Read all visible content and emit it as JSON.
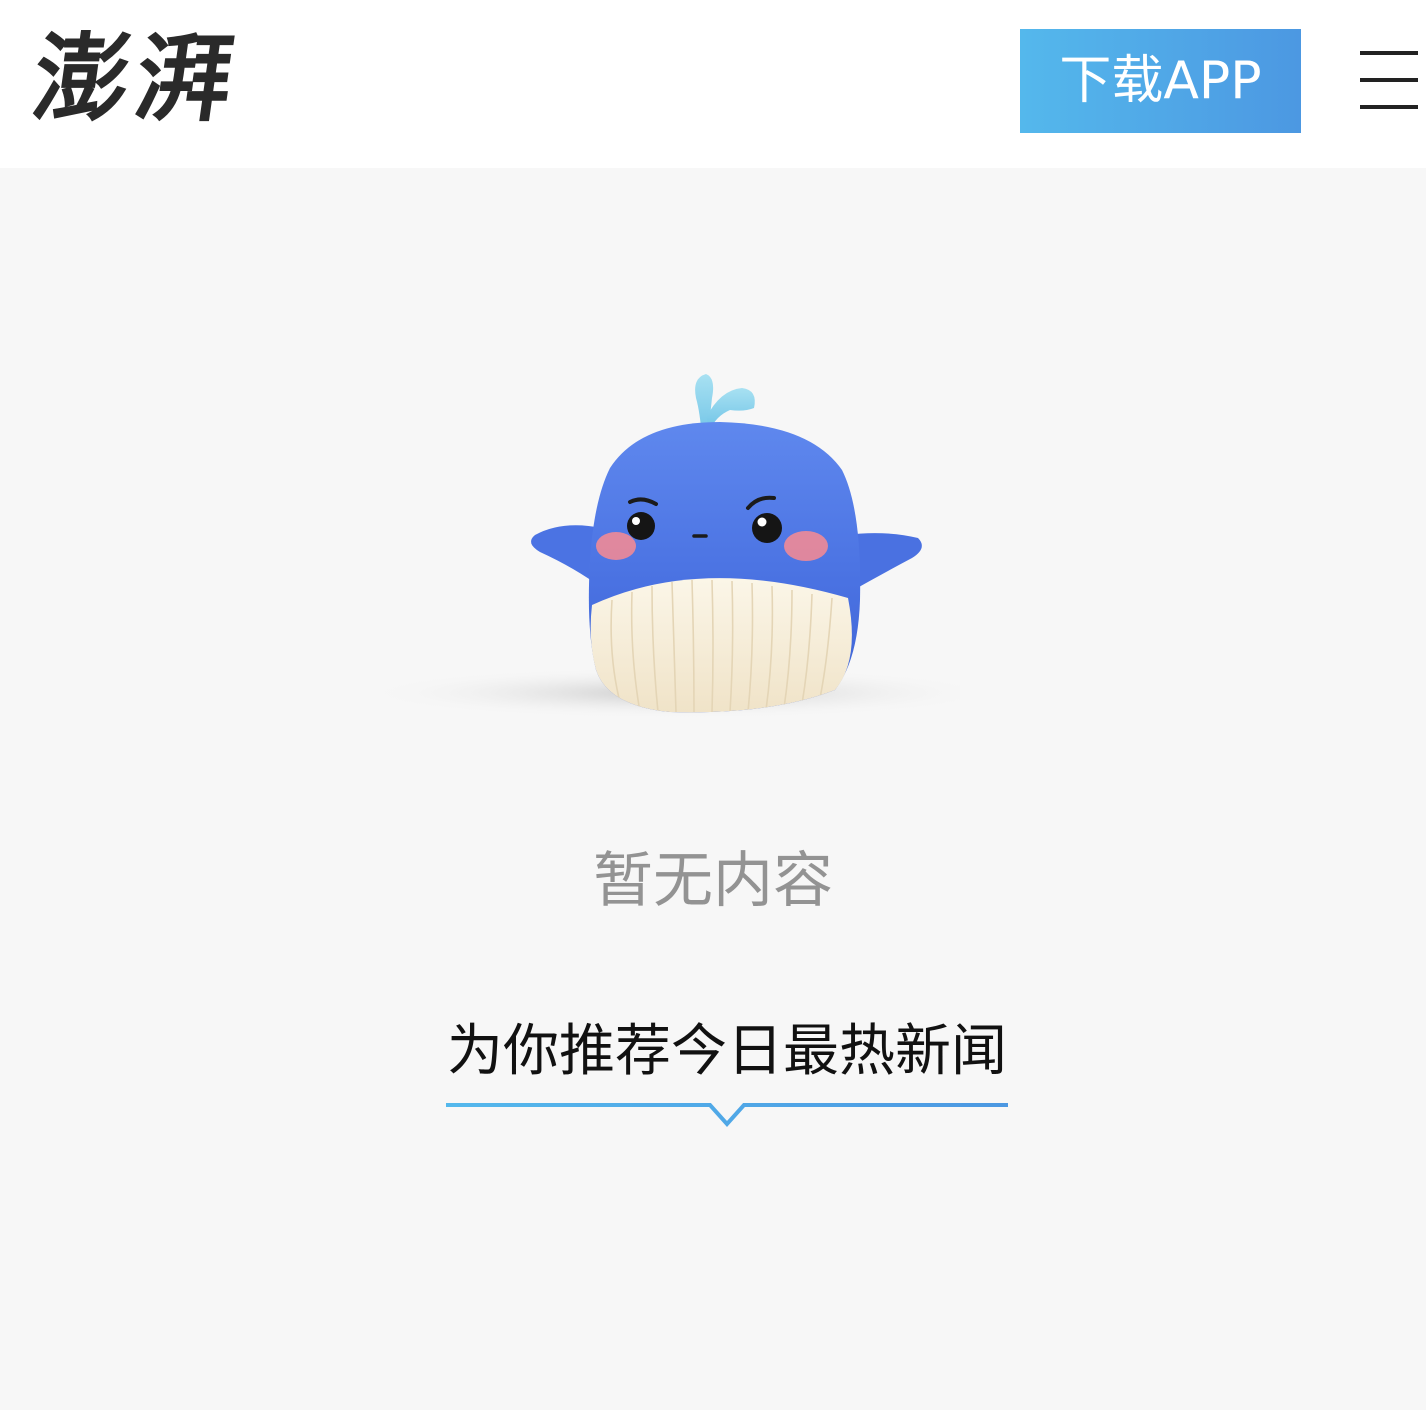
{
  "header": {
    "logo_text": "澎湃",
    "download_label": "下载APP",
    "menu_icon": "hamburger-menu-icon"
  },
  "empty_state": {
    "illustration": "sad-whale-mascot",
    "message": "暂无内容"
  },
  "recommend": {
    "title": "为你推荐今日最热新闻",
    "indicator_icon": "chevron-down-icon"
  },
  "colors": {
    "accent_start": "#54b8ec",
    "accent_end": "#4c98e2",
    "background": "#f7f7f7",
    "header_background": "#ffffff",
    "muted_text": "#939393"
  }
}
